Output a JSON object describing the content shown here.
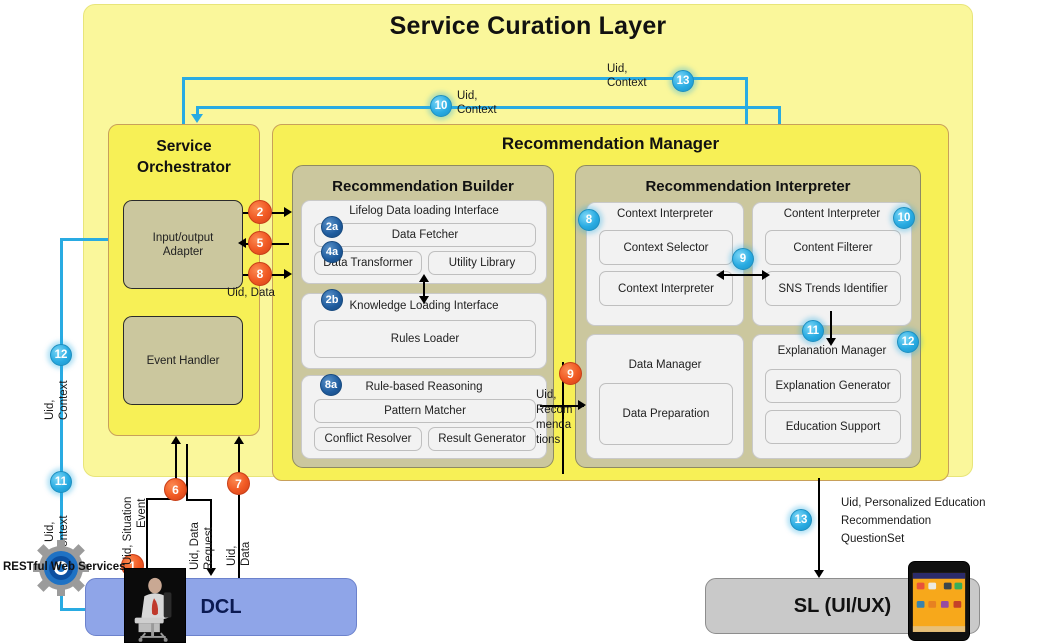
{
  "diagram": {
    "title": "Service Curation Layer"
  },
  "orchestrator": {
    "title": "Service\nOrchestrator",
    "title_line1": "Service",
    "title_line2": "Orchestrator",
    "boxes": [
      {
        "label": "Input/output\nAdapter"
      },
      {
        "label": "Event  Handler"
      }
    ]
  },
  "recommendation_manager": {
    "title": "Recommendation  Manager",
    "builder": {
      "title": "Recommendation Builder",
      "groups": [
        {
          "label": "Lifelog Data loading Interface",
          "items": [
            "Data Fetcher",
            "Data Transformer",
            "Utility Library"
          ]
        },
        {
          "label": "Knowledge Loading Interface",
          "items": [
            "Rules Loader"
          ]
        },
        {
          "label": "Rule-based Reasoning",
          "items": [
            "Pattern Matcher",
            "Conflict Resolver",
            "Result Generator"
          ]
        }
      ]
    },
    "interpreter": {
      "title": "Recommendation Interpreter",
      "groups": [
        {
          "label": "Context  Interpreter",
          "items": [
            "Context  Selector",
            "Context  Interpreter"
          ]
        },
        {
          "label": "Content  Interpreter",
          "items": [
            "Content  Filterer",
            "SNS Trends Identifier"
          ]
        },
        {
          "label": "Data Manager",
          "items": [
            "Data Preparation"
          ]
        },
        {
          "label": "Explanation Manager",
          "items": [
            "Explanation Generator",
            "Education Support"
          ]
        }
      ]
    }
  },
  "external": {
    "dcl_label": "DCL",
    "sl_label": "SL (UI/UX)",
    "rest_label": "RESTful Web Services"
  },
  "badges": {
    "b1": "1",
    "b2": "2",
    "b5": "5",
    "b6": "6",
    "b7": "7",
    "b8_orch": "8",
    "b9": "9",
    "b2a": "2a",
    "b4a": "4a",
    "b2b": "2b",
    "b8a": "8a",
    "b8_ctx": "8",
    "b9_mid": "9",
    "b10_content": "10",
    "b10_top": "10",
    "b11_exp": "11",
    "b12_exp": "12",
    "b11_left": "11",
    "b12_left": "12",
    "b13_top": "13",
    "b13_bottom": "13"
  },
  "flow_labels": {
    "uid_data": "Uid, Data",
    "uid_recommendations": "Uid,\nRecom\nmenda\ntions",
    "uid_context_10": "Uid,\nContext",
    "uid_context_13": "Uid,\nContext",
    "uid_context_12_left": "Uid,\nContext",
    "uid_context_11_left": "Uid,\nContext",
    "uid_situation_event": "Uid, Situation Event",
    "uid_data_request": "Uid, Data Request",
    "uid_data_7": "Uid, Data",
    "sl_message": "Uid, Personalized Education\nRecommendation\nQuestionSet"
  },
  "colors": {
    "outer_panel": "#FAF79B",
    "inner_panel": "#F7F056",
    "olive": "#CBC79E",
    "light_box": "#F2F2F2",
    "badge_orange": "#F15A24",
    "badge_cyan": "#29ABE2",
    "badge_navy": "#1F5C9E",
    "dcl": "#8FA5E8",
    "sl": "#C9C9C9",
    "connector_cyan": "#29ABE2"
  }
}
